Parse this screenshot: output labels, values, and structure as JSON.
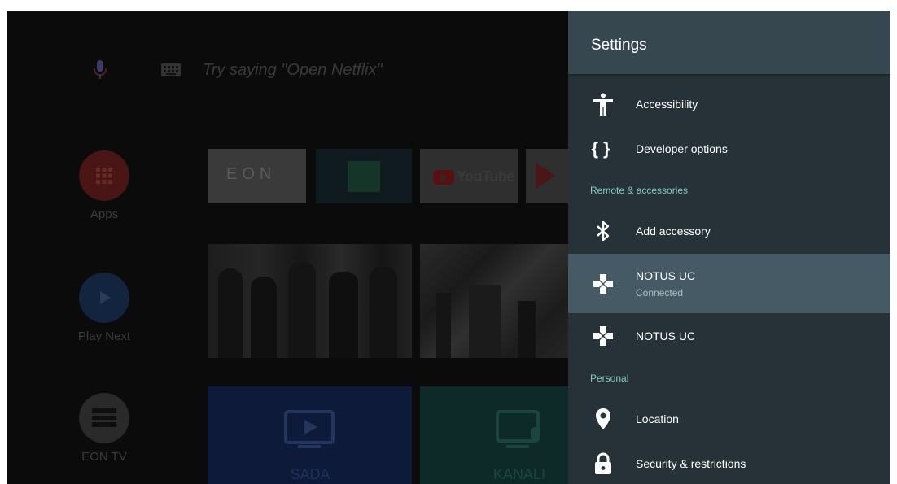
{
  "launcher": {
    "search_hint": "Try saying \"Open Netflix\"",
    "side_apps": [
      {
        "label": "Apps"
      },
      {
        "label": "Play Next"
      },
      {
        "label": "EON TV"
      }
    ],
    "row1_tiles": [
      {
        "name": "eon",
        "text": "EON"
      },
      {
        "name": "android"
      },
      {
        "name": "youtube",
        "text": "YouTube"
      },
      {
        "name": "google-play"
      }
    ],
    "row3_tiles": [
      {
        "label": "SADA"
      },
      {
        "label": "KANALI"
      }
    ]
  },
  "settings": {
    "title": "Settings",
    "items": {
      "accessibility": "Accessibility",
      "developer": "Developer options",
      "section_remote": "Remote & accessories",
      "add_accessory": "Add accessory",
      "notus1_title": "NOTUS UC",
      "notus1_subtitle": "Connected",
      "notus2_title": "NOTUS UC",
      "section_personal": "Personal",
      "location": "Location",
      "security": "Security & restrictions"
    }
  },
  "colors": {
    "panel_bg": "#263238",
    "header_bg": "#37474f",
    "focused_bg": "#455a64",
    "section_text": "#80cbc4"
  }
}
